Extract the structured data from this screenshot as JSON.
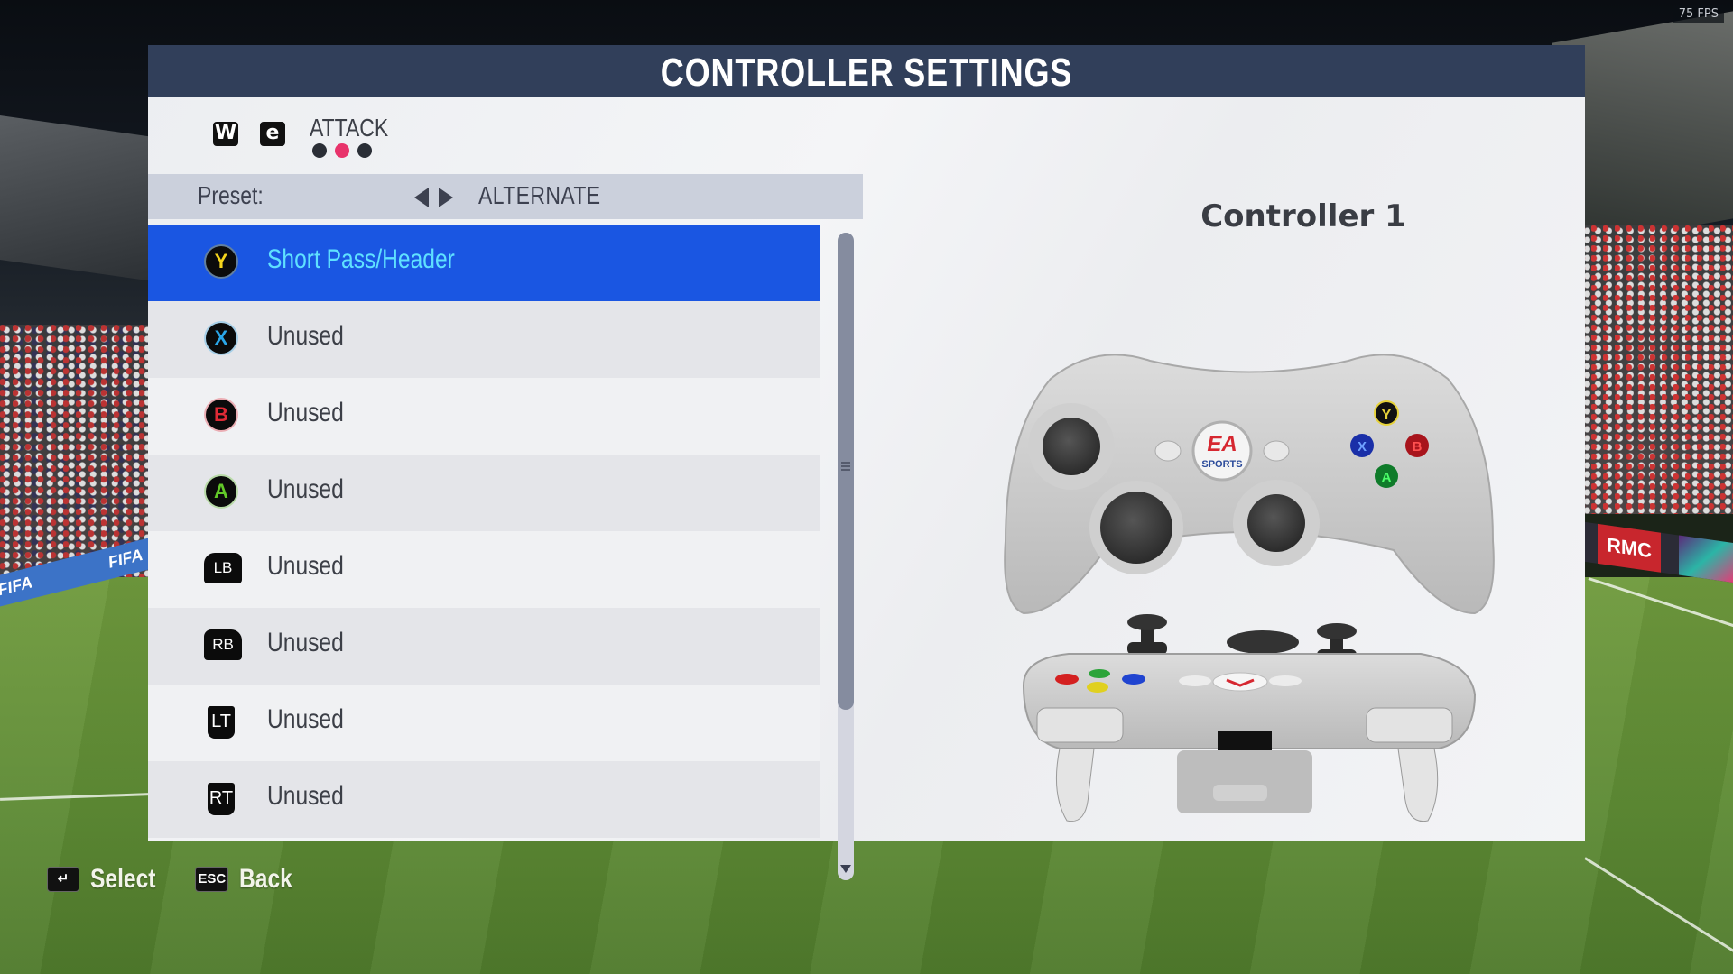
{
  "overlay": {
    "fps": "75 FPS"
  },
  "background": {
    "ad_left": "FIFA",
    "ad_left_2": "FIFA",
    "ad_right": "RMC"
  },
  "header": {
    "title": "CONTROLLER SETTINGS"
  },
  "tabs": {
    "prev_key": "W",
    "next_key": "e",
    "current": "ATTACK",
    "page_count": 3,
    "active_index": 1
  },
  "preset": {
    "label": "Preset:",
    "value": "ALTERNATE"
  },
  "bindings": [
    {
      "button": "Y",
      "type": "face",
      "color": "#f5d51c",
      "action": "Short Pass/Header",
      "selected": true
    },
    {
      "button": "X",
      "type": "face",
      "color": "#2aa6e8",
      "action": "Unused",
      "selected": false
    },
    {
      "button": "B",
      "type": "face",
      "color": "#e02b36",
      "action": "Unused",
      "selected": false
    },
    {
      "button": "A",
      "type": "face",
      "color": "#62c928",
      "action": "Unused",
      "selected": false
    },
    {
      "button": "LB",
      "type": "bumper",
      "color": "#ffffff",
      "action": "Unused",
      "selected": false
    },
    {
      "button": "RB",
      "type": "bumper",
      "color": "#ffffff",
      "action": "Unused",
      "selected": false
    },
    {
      "button": "LT",
      "type": "trigger",
      "color": "#ffffff",
      "action": "Unused",
      "selected": false
    },
    {
      "button": "RT",
      "type": "trigger",
      "color": "#ffffff",
      "action": "Unused",
      "selected": false
    }
  ],
  "controller": {
    "title": "Controller 1",
    "logo_top": "EA",
    "logo_bottom": "SPORTS"
  },
  "footer": {
    "select_key": "↵",
    "select_label": "Select",
    "back_key": "ESC",
    "back_label": "Back"
  },
  "colors": {
    "header_bg": "#313f5a",
    "selected_row": "#1a56e2",
    "selected_text": "#5fe1ff",
    "active_dot": "#e8336b"
  }
}
